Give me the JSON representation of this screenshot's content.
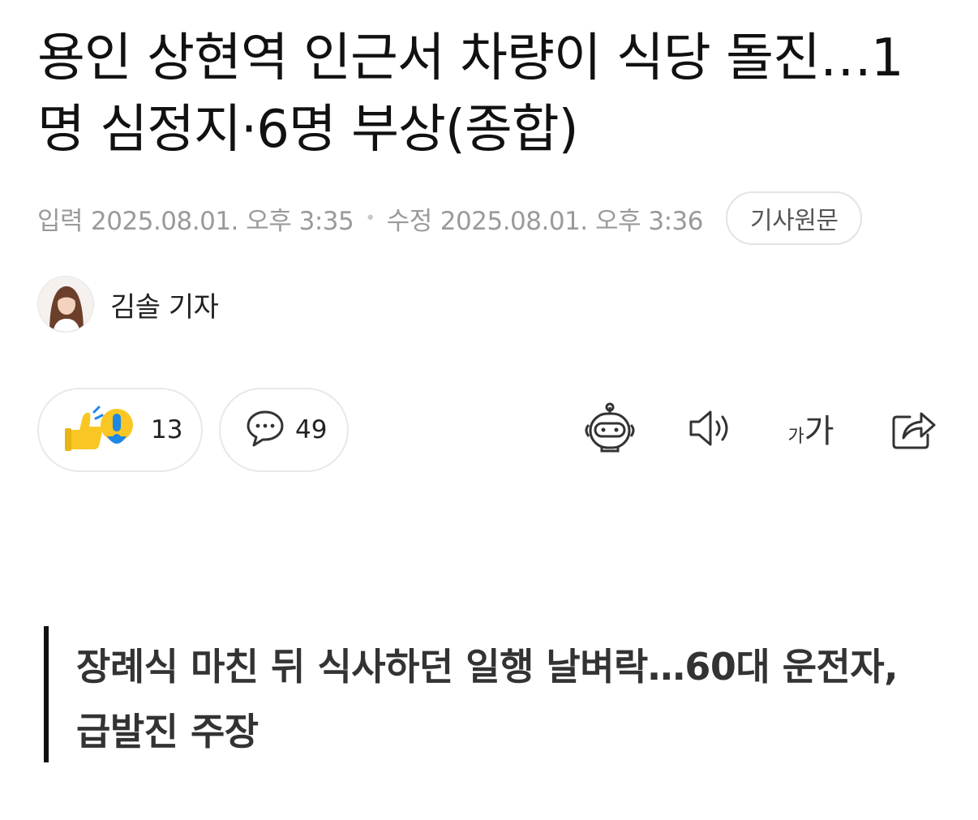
{
  "article": {
    "headline": "용인 상현역 인근서 차량이 식당 돌진…1명 심정지·6명 부상(종합)",
    "input_label": "입력",
    "input_time": "2025.08.01. 오후 3:35",
    "separator": "•",
    "modified_label": "수정",
    "modified_time": "2025.08.01. 오후 3:36",
    "original_button": "기사원문",
    "reporter": "김솔 기자",
    "subheadline": "장례식 마친 뒤 식사하던 일행 날벼락…60대 운전자, 급발진 주장"
  },
  "reactions": {
    "reaction_count": "13",
    "comment_count": "49"
  },
  "toolbar": {
    "font_small": "가",
    "font_big": "가",
    "icons": [
      "robot-summary-icon",
      "speaker-icon",
      "font-size-icon",
      "share-icon"
    ]
  },
  "colors": {
    "text_primary": "#111111",
    "text_meta": "#9a9a9a",
    "border": "#e8e8e8",
    "emoji_yellow": "#f9c623",
    "emoji_blue": "#1e88e5"
  }
}
